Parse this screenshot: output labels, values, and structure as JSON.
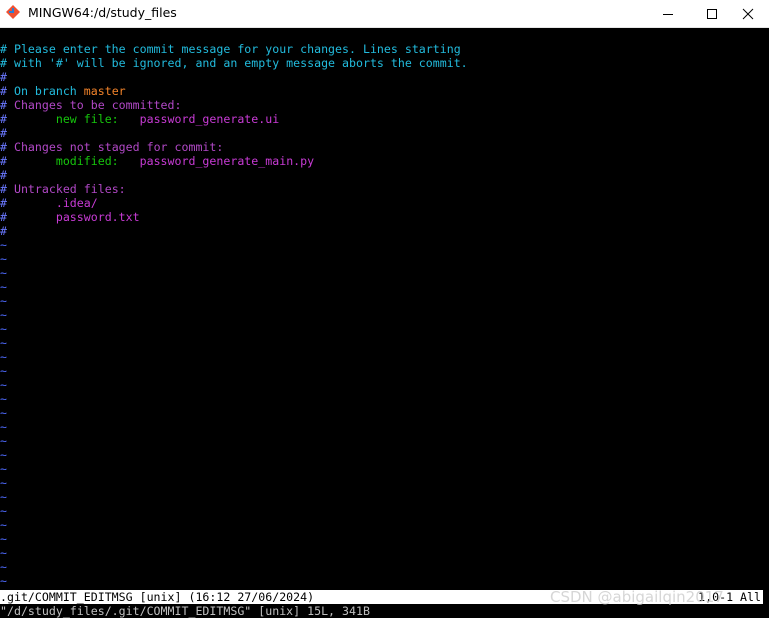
{
  "window": {
    "title": "MINGW64:/d/study_files",
    "icon": "git-bash-icon",
    "controls": {
      "minimize": "minimize-icon",
      "maximize": "maximize-icon",
      "close": "close-icon"
    }
  },
  "editor": {
    "lines": [
      {
        "parts": [
          {
            "text": "# Please enter the commit message for your changes. Lines starting",
            "color": "cyan2"
          }
        ]
      },
      {
        "parts": [
          {
            "text": "# with '#' will be ignored, and an empty message aborts the commit.",
            "color": "cyan2"
          }
        ]
      },
      {
        "parts": [
          {
            "text": "#",
            "color": "hash"
          }
        ]
      },
      {
        "parts": [
          {
            "text": "# ",
            "color": "hash"
          },
          {
            "text": "On branch ",
            "color": "cyan2"
          },
          {
            "text": "master",
            "color": "orange"
          }
        ]
      },
      {
        "parts": [
          {
            "text": "# ",
            "color": "hash"
          },
          {
            "text": "Changes to be committed:",
            "color": "purple"
          }
        ]
      },
      {
        "parts": [
          {
            "text": "#       ",
            "color": "hash"
          },
          {
            "text": "new file:   ",
            "color": "green"
          },
          {
            "text": "password_generate.ui",
            "color": "magenta"
          }
        ]
      },
      {
        "parts": [
          {
            "text": "#",
            "color": "hash"
          }
        ]
      },
      {
        "parts": [
          {
            "text": "# ",
            "color": "hash"
          },
          {
            "text": "Changes not staged for commit:",
            "color": "purple"
          }
        ]
      },
      {
        "parts": [
          {
            "text": "#       ",
            "color": "hash"
          },
          {
            "text": "modified:   ",
            "color": "green"
          },
          {
            "text": "password_generate_main.py",
            "color": "magenta"
          }
        ]
      },
      {
        "parts": [
          {
            "text": "#",
            "color": "hash"
          }
        ]
      },
      {
        "parts": [
          {
            "text": "# ",
            "color": "hash"
          },
          {
            "text": "Untracked files:",
            "color": "purple"
          }
        ]
      },
      {
        "parts": [
          {
            "text": "#       ",
            "color": "hash"
          },
          {
            "text": ".idea/",
            "color": "magenta"
          }
        ]
      },
      {
        "parts": [
          {
            "text": "#       ",
            "color": "hash"
          },
          {
            "text": "password.txt",
            "color": "magenta"
          }
        ]
      },
      {
        "parts": [
          {
            "text": "#",
            "color": "hash"
          }
        ]
      }
    ],
    "tilde_char": "~",
    "empty_line_count": 25
  },
  "status": {
    "left": ".git/COMMIT_EDITMSG [unix] (16:12 27/06/2024)",
    "right": "1,0-1 All"
  },
  "message_line": "\"/d/study_files/.git/COMMIT_EDITMSG\" [unix] 15L, 341B",
  "watermark": "CSDN @abigailqin2017",
  "colors": {
    "cyan2": "#22bbdd",
    "hash": "#6a78ff",
    "orange": "#f2832a",
    "purple": "#b148c6",
    "green": "#16c60c",
    "magenta": "#c83bd5",
    "tilde": "#4f6bff",
    "background": "#000000",
    "titlebar": "#ffffff"
  }
}
